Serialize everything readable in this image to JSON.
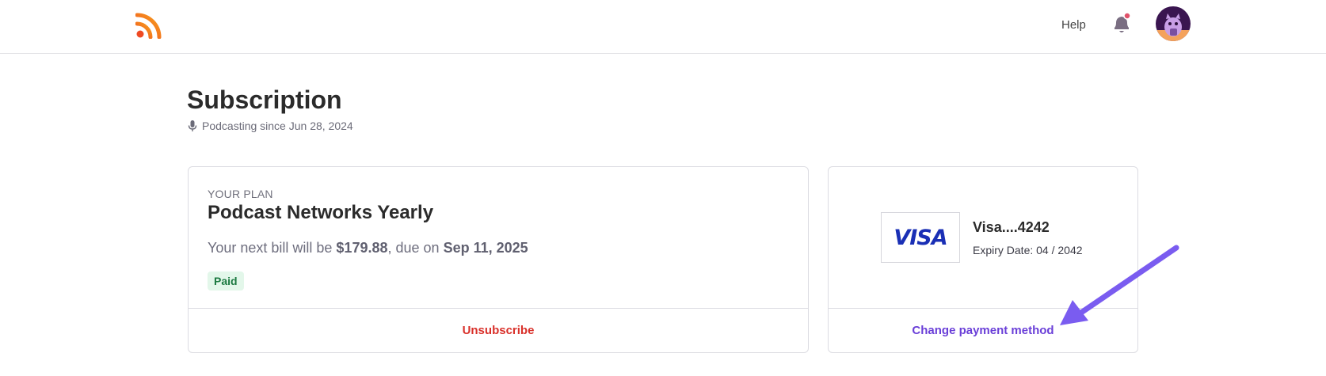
{
  "header": {
    "logo_icon": "rss-icon",
    "help_label": "Help",
    "bell_icon": "bell-icon",
    "notification_dot_color": "#e0526b",
    "avatar_icon": "avatar-icon"
  },
  "page": {
    "title": "Subscription",
    "since_icon": "microphone-icon",
    "since_text": "Podcasting since Jun 28, 2024"
  },
  "plan": {
    "kicker": "YOUR PLAN",
    "name": "Podcast Networks Yearly",
    "bill_prefix": "Your next bill will be ",
    "amount": "$179.88",
    "bill_middle": ", due on ",
    "due_date": "Sep 11, 2025",
    "status": "Paid",
    "unsubscribe_label": "Unsubscribe"
  },
  "payment": {
    "brand_logo": "VISA",
    "card_label": "Visa....4242",
    "expiry_label": "Expiry Date: 04 / 2042",
    "change_label": "Change payment method"
  },
  "colors": {
    "accent_purple": "#6a3fd8",
    "danger_red": "#d9302a",
    "paid_green": "#1c7a41",
    "rss_orange": "#f28b22",
    "visa_blue": "#1a2fb5",
    "annotation_arrow": "#7a5cf0"
  }
}
